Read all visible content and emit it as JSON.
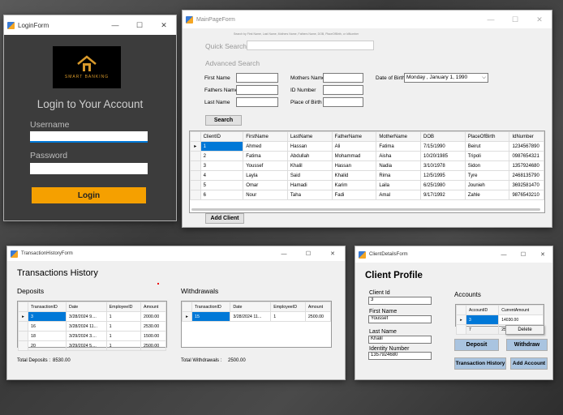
{
  "login": {
    "title": "LoginForm",
    "logo_text": "SMART BANKING",
    "heading": "Login to Your Account",
    "username_label": "Username",
    "username_value": "",
    "password_label": "Password",
    "password_value": "",
    "login_button": "Login"
  },
  "main": {
    "title": "MainPageForm",
    "hint": "Search by First Name, Last Name, Mothers Name, Fathers Name, DOB, PlaceOfBirth, or IdNumber",
    "quick_search_label": "Quick Search",
    "quick_search_value": "",
    "advanced_label": "Advanced Search",
    "first_name_label": "First Name",
    "fathers_name_label": "Fathers Name",
    "last_name_label": "Last Name",
    "mothers_name_label": "Mothers Name",
    "id_number_label": "ID Number",
    "place_label": "Place of Birth",
    "dob_label": "Date of Birth",
    "dob_value": "Monday  ,   January    1, 1990",
    "search_button": "Search",
    "add_client_button": "Add Client",
    "columns": [
      "ClientID",
      "FirstName",
      "LastName",
      "FatherName",
      "MotherName",
      "DOB",
      "PlaceOfBirth",
      "IdNumber"
    ],
    "rows": [
      [
        "1",
        "Ahmed",
        "Hassan",
        "Ali",
        "Fatima",
        "7/15/1990",
        "Beirut",
        "1234567890"
      ],
      [
        "2",
        "Fatima",
        "Abdullah",
        "Mohammad",
        "Aisha",
        "10/20/1985",
        "Tripoli",
        "0987654321"
      ],
      [
        "3",
        "Youssef",
        "Khalil",
        "Hassan",
        "Nadia",
        "3/10/1978",
        "Sidon",
        "1357924680"
      ],
      [
        "4",
        "Layla",
        "Said",
        "Khalid",
        "Rima",
        "12/5/1995",
        "Tyre",
        "2468135790"
      ],
      [
        "5",
        "Omar",
        "Hamadi",
        "Karim",
        "Laila",
        "6/25/1980",
        "Jounieh",
        "3692581470"
      ],
      [
        "6",
        "Nour",
        "Taha",
        "Fadi",
        "Amal",
        "9/17/1992",
        "Zahle",
        "9876543210"
      ]
    ]
  },
  "tx": {
    "title": "TransactionHistoryForm",
    "heading": "Transactions History",
    "deposits_label": "Deposits",
    "withdrawals_label": "Withdrawals",
    "dep_columns": [
      "TransactionID",
      "Date",
      "EmployeeID",
      "Amount"
    ],
    "dep_rows": [
      [
        "3",
        "3/28/2024 9....",
        "1",
        "2000.00"
      ],
      [
        "16",
        "3/28/2024 11...",
        "1",
        "2530.00"
      ],
      [
        "18",
        "3/29/2024 3....",
        "1",
        "1500.00"
      ],
      [
        "20",
        "3/29/2024 5....",
        "1",
        "2500.00"
      ]
    ],
    "wd_columns": [
      "TransactionID",
      "Date",
      "EmployeeID",
      "Amount"
    ],
    "wd_rows": [
      [
        "15",
        "3/28/2024 11...",
        "1",
        "2500.00"
      ]
    ],
    "total_dep_label": "Total Deposits :",
    "total_dep_value": "8530.00",
    "total_wd_label": "Total Withdrawals :",
    "total_wd_value": "2500.00"
  },
  "client": {
    "title": "ClientDetailsForm",
    "heading": "Client Profile",
    "client_id_label": "Client Id",
    "client_id_value": "3",
    "first_name_label": "First Name",
    "first_name_value": "Youssef",
    "last_name_label": "Last Name",
    "last_name_value": "Khalil",
    "identity_label": "Identity Number",
    "identity_value": "1357924680",
    "accounts_label": "Accounts",
    "acc_columns": [
      "AccountID",
      "CurrentAmount"
    ],
    "acc_rows": [
      [
        "3",
        "14030.00"
      ],
      [
        "7",
        "250.00"
      ]
    ],
    "delete_menu": "Delete",
    "deposit_button": "Deposit",
    "withdraw_button": "Withdraw",
    "history_button": "Transaction History",
    "add_account_button": "Add Account"
  },
  "controls": {
    "min": "—",
    "max": "☐",
    "close": "✕"
  }
}
